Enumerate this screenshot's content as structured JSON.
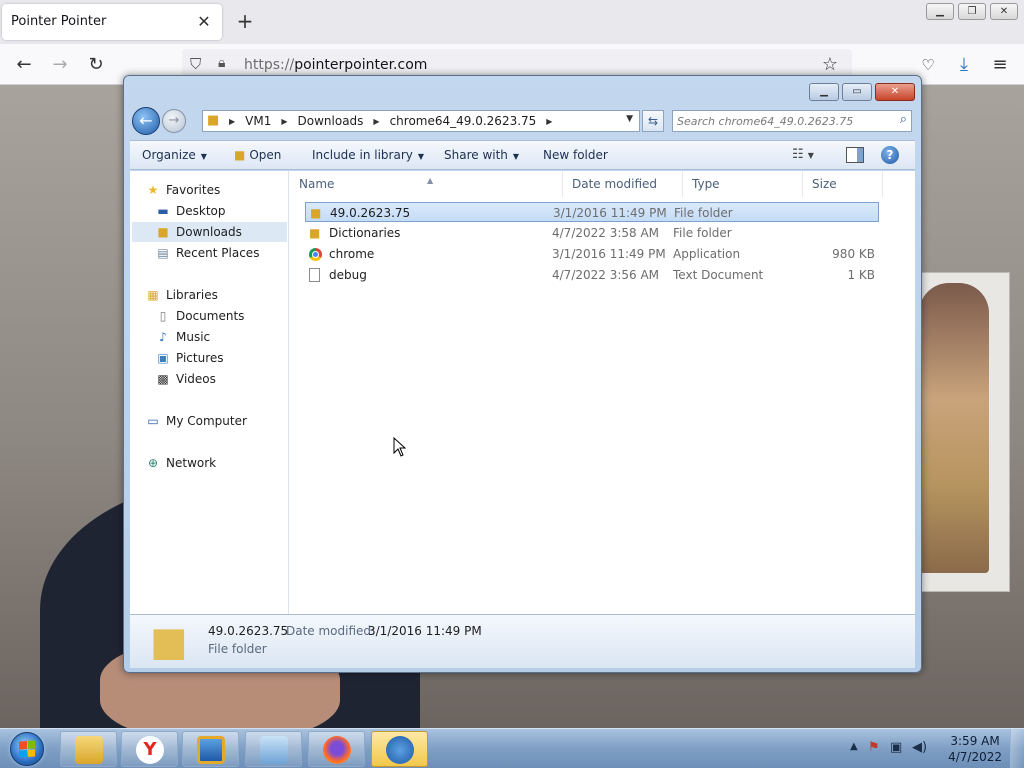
{
  "browser": {
    "tab_title": "Pointer Pointer",
    "url_protocol": "https://",
    "url_host": "pointerpointer.com"
  },
  "explorer": {
    "breadcrumbs": [
      "VM1",
      "Downloads",
      "chrome64_49.0.2623.75"
    ],
    "search_placeholder": "Search chrome64_49.0.2623.75",
    "toolbar": {
      "organize": "Organize",
      "open": "Open",
      "include_in_library": "Include in library",
      "share_with": "Share with",
      "new_folder": "New folder"
    },
    "nav": {
      "favorites": "Favorites",
      "desktop": "Desktop",
      "downloads": "Downloads",
      "recent_places": "Recent Places",
      "libraries": "Libraries",
      "documents": "Documents",
      "music": "Music",
      "pictures": "Pictures",
      "videos": "Videos",
      "my_computer": "My Computer",
      "network": "Network"
    },
    "columns": {
      "name": "Name",
      "date": "Date modified",
      "type": "Type",
      "size": "Size"
    },
    "files": [
      {
        "name": "49.0.2623.75",
        "date": "3/1/2016 11:49 PM",
        "type": "File folder",
        "size": "",
        "icon": "folder-icon"
      },
      {
        "name": "Dictionaries",
        "date": "4/7/2022 3:58 AM",
        "type": "File folder",
        "size": "",
        "icon": "folder-icon"
      },
      {
        "name": "chrome",
        "date": "3/1/2016 11:49 PM",
        "type": "Application",
        "size": "980 KB",
        "icon": "chrome-icon"
      },
      {
        "name": "debug",
        "date": "4/7/2022 3:56 AM",
        "type": "Text Document",
        "size": "1 KB",
        "icon": "text-document-icon"
      }
    ],
    "details": {
      "name": "49.0.2623.75",
      "date_label": "Date modified:",
      "date": "3/1/2016 11:49 PM",
      "type": "File folder"
    }
  },
  "taskbar": {
    "time": "3:59 AM",
    "date": "4/7/2022"
  },
  "colors": {
    "selection": "#c4dcf7",
    "taskbar": "#7f9fc4",
    "folder": "#d9a62a"
  }
}
